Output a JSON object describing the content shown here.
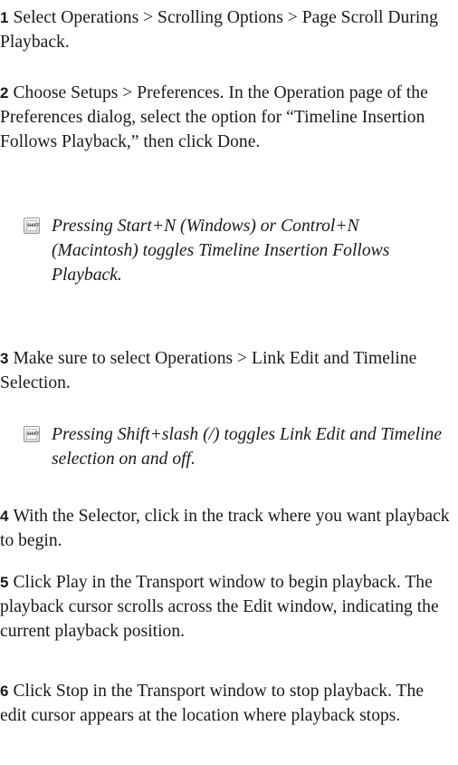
{
  "steps": [
    {
      "num": "1",
      "text": "Select Operations > Scrolling Options > Page Scroll During Playback."
    },
    {
      "num": "2",
      "text": "Choose Setups > Preferences. In the Operation page of the Preferences dialog, select the option for “Timeline Insertion Follows Playback,” then click Done."
    },
    {
      "num": "3",
      "text": "Make sure to select Operations > Link Edit and Timeline Selection."
    },
    {
      "num": "4",
      "text": "With the Selector, click in the track where you want playback to begin."
    },
    {
      "num": "5",
      "text": "Click Play in the Transport window to begin playback. The playback cursor scrolls across the Edit window, indicating the current playback position."
    },
    {
      "num": "6",
      "text": "Click Stop in the Transport window to stop playback. The edit cursor appears at the location where playback stops."
    }
  ],
  "tips": [
    {
      "icon_label": "SHIFT",
      "icon": "shift-key-icon",
      "text": "Pressing Start+N (Windows) or Control+N (Macintosh) toggles Timeline Insertion Follows Playback."
    },
    {
      "icon_label": "SHIFT",
      "icon": "shift-key-icon",
      "text": "Pressing Shift+slash (/) toggles Link Edit and Timeline selection on and off."
    }
  ]
}
